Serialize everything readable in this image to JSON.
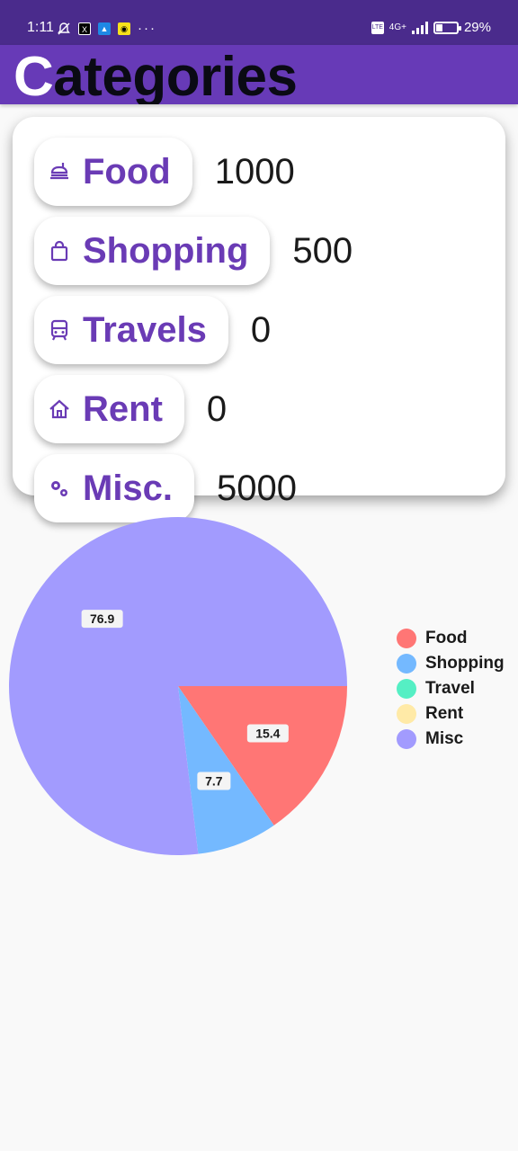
{
  "status_bar": {
    "time": "1:11",
    "network": "4G+",
    "battery": "29%",
    "battery_level": 0.29
  },
  "header": {
    "title_first": "C",
    "title_rest": "ategories"
  },
  "categories": [
    {
      "label": "Food",
      "value": "1000",
      "icon": "food-icon"
    },
    {
      "label": "Shopping",
      "value": "500",
      "icon": "shopping-bag-icon"
    },
    {
      "label": "Travels",
      "value": "0",
      "icon": "train-icon"
    },
    {
      "label": "Rent",
      "value": "0",
      "icon": "home-icon"
    },
    {
      "label": "Misc.",
      "value": "5000",
      "icon": "gears-icon"
    }
  ],
  "chart_data": {
    "type": "pie",
    "legend_position": "right",
    "slices": [
      {
        "name": "Food",
        "value": 15.4,
        "label": "15.4",
        "color": "#ff7675"
      },
      {
        "name": "Shopping",
        "value": 7.7,
        "label": "7.7",
        "color": "#74b9ff"
      },
      {
        "name": "Travel",
        "value": 0,
        "label": "",
        "color": "#55efc4"
      },
      {
        "name": "Rent",
        "value": 0,
        "label": "",
        "color": "#ffeaa7"
      },
      {
        "name": "Misc",
        "value": 76.9,
        "label": "76.9",
        "color": "#a29bfe"
      }
    ]
  }
}
